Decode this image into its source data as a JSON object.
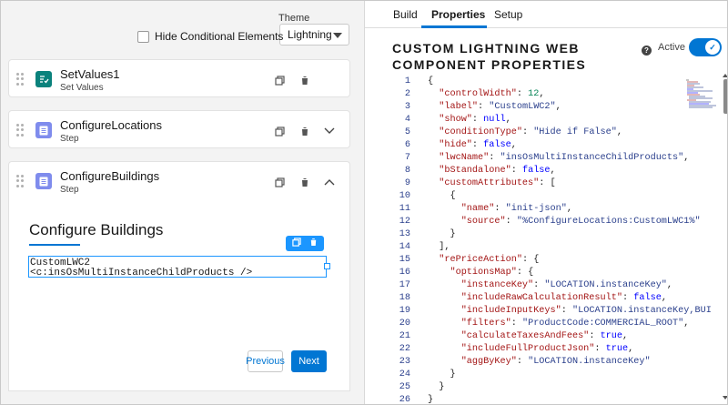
{
  "theme": {
    "label": "Theme",
    "selected": "Lightning"
  },
  "hide_conditional_label": "Hide Conditional Elements",
  "steps": [
    {
      "title": "SetValues1",
      "subtitle": "Set Values",
      "icon": "set-values-icon",
      "icon_color": "#0b827c"
    },
    {
      "title": "ConfigureLocations",
      "subtitle": "Step",
      "icon": "step-icon",
      "icon_color": "#7f8ced"
    },
    {
      "title": "ConfigureBuildings",
      "subtitle": "Step",
      "icon": "step-icon",
      "icon_color": "#7f8ced"
    }
  ],
  "build_panel": {
    "heading": "Configure Buildings",
    "component_line1": "CustomLWC2",
    "component_line2": "<c:insOsMultiInstanceChildProducts />",
    "previous_label": "Previous",
    "next_label": "Next"
  },
  "tabs": [
    {
      "label": "Build",
      "active": false
    },
    {
      "label": "Properties",
      "active": true
    },
    {
      "label": "Setup",
      "active": false
    }
  ],
  "properties": {
    "title": "CUSTOM LIGHTNING WEB COMPONENT PROPERTIES",
    "active_label": "Active",
    "active": true
  },
  "code_lines": [
    "{",
    "  \"controlWidth\": 12,",
    "  \"label\": \"CustomLWC2\",",
    "  \"show\": null,",
    "  \"conditionType\": \"Hide if False\",",
    "  \"hide\": false,",
    "  \"lwcName\": \"insOsMultiInstanceChildProducts\",",
    "  \"bStandalone\": false,",
    "  \"customAttributes\": [",
    "    {",
    "      \"name\": \"init-json\",",
    "      \"source\": \"%ConfigureLocations:CustomLWC1%\"",
    "    }",
    "  ],",
    "  \"rePriceAction\": {",
    "    \"optionsMap\": {",
    "      \"instanceKey\": \"LOCATION.instanceKey\",",
    "      \"includeRawCalculationResult\": false,",
    "      \"includeInputKeys\": \"LOCATION.instanceKey,BUI",
    "      \"filters\": \"ProductCode:COMMERCIAL_ROOT\",",
    "      \"calculateTaxesAndFees\": true,",
    "      \"includeFullProductJson\": true,",
    "      \"aggByKey\": \"LOCATION.instanceKey\"",
    "    }",
    "  }",
    "}"
  ],
  "colors": {
    "accent": "#0176d3",
    "selection": "#1b96ff"
  }
}
